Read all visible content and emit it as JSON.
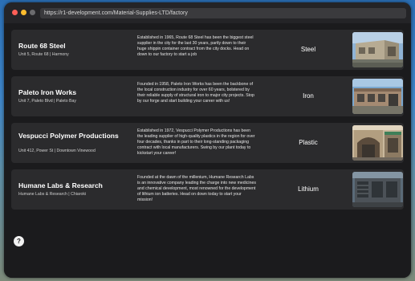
{
  "window": {
    "url": "https://r1-development.com/Material-Supplies-LTD/factory",
    "colors": {
      "close": "#ff5f57",
      "minimize": "#febc2e",
      "inactive": "#6b6b6e"
    }
  },
  "factories": [
    {
      "name": "Route 68 Steel",
      "address": "Unit 5, Route 68 | Harmony",
      "description": "Established in 1965, Route 68 Steel has been the biggest steel supplier in the city for the last 30 years, partly down to their huge shippin container contract from the city docks. Head on down to our factory to start a job",
      "material": "Steel",
      "image": "warehouse-photo"
    },
    {
      "name": "Paleto Iron Works",
      "address": "Unit 7, Paleto Blvd | Paleto Bay",
      "description": "Founded in 1958, Paleto Iron Works has been the backbone of the local construction industry for over 60 years, bolstered by their reliable supply of structural iron to major city projects. Stop by our forge and start building your career with us!",
      "material": "Iron",
      "image": "ironworks-photo"
    },
    {
      "name": "Vespucci Polymer Productions",
      "address": "Unit 412, Power St | Downtown Vinewood",
      "description": "Established in 1972, Vespucci Polymer Productions has been the leading supplier of high-quality plastics in the region for over four decades, thanks in part to their long-standing packaging contract with local manufacturers. Swing by our plant today to kickstart your career!",
      "material": "Plastic",
      "image": "storefront-photo"
    },
    {
      "name": "Humane Labs & Research",
      "address": "Humane Labs & Research | Chiaroki",
      "description": "Founded at the dawn of the millenium, Humane Research Labs is an innovative company leading the charge into new medicines and chemical development, most renowned for the development of lithium ion batteries. Head on down today to start your mission!",
      "material": "Lithium",
      "image": "lab-photo"
    }
  ],
  "help": {
    "label": "?"
  }
}
